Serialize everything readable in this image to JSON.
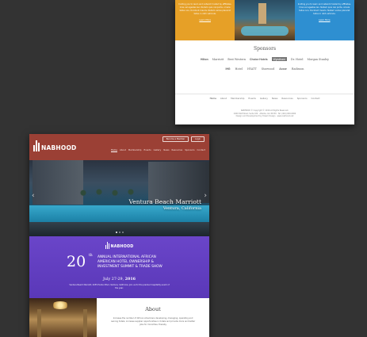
{
  "top_page": {
    "tiles": {
      "left_text": "Inviting you to learn and network hosted by affiliates. Cras vel egestas leo. Nullam quis nisi porta, ornare tellus non, tincidunt mauris. Nullam varius placerat tellus in nibh vehicula.",
      "left_link": "Learn More",
      "right_text": "Inviting you to learn and network hosted by affiliates. Cras vel egestas leo. Nullam quis nisi porta, ornare tellus non, tincidunt mauris. Nullam varius placerat tellus in nibh vehicula.",
      "right_link": "Learn More"
    },
    "sponsors_title": "Sponsors",
    "sponsors_row1": [
      "Hilton",
      "Marriott",
      "Best Western",
      "Choice Hotels",
      "Wyndham",
      "Dr. Hotel",
      "Morgan Stanley"
    ],
    "sponsors_row2": [
      "IHG",
      "Hotel",
      "HYATT",
      "Starwood",
      "Accor",
      "Radisson"
    ],
    "footer_nav": [
      "Home",
      "About",
      "Membership",
      "Events",
      "Gallery",
      "News",
      "Resources",
      "Sponsors",
      "Contact"
    ],
    "footer_copy_1": "NABHOOD © Copyright © 2016 All Rights Reserved.",
    "footer_copy_2": "4400 Wolf Road, Suite 100 · Atlanta, GA 30339 · Tel: (404) 000-0000",
    "footer_copy_3": "Design and Development by Dream Design · www.nabhood.net"
  },
  "main_page": {
    "logo": "NABHOOD",
    "header_buttons": [
      "Become a Member",
      "Login"
    ],
    "nav": [
      "Home",
      "About",
      "Membership",
      "Events",
      "Gallery",
      "News",
      "Resources",
      "Sponsors",
      "Contact"
    ],
    "hero": {
      "title": "Ventura Beach Marriott",
      "subtitle": "Ventura, California",
      "slide_count": 3,
      "active_slide": 1
    },
    "event": {
      "logo": "NABHOOD",
      "number": "20",
      "suffix": "th",
      "title_line1": "ANNUAL INTERNATIONAL AFRICAN",
      "title_line2": "AMERICAN HOTEL OWNERSHIP &",
      "title_line3": "INVESTMENT SUMMIT & TRADE SHOW",
      "date_prefix": "July 27-29, ",
      "date_year": "2016",
      "desc": "Ventura Beach Marriott, 2055 Harbor Blvd, Ventura, California. Join us for the premier hospitality event of the year."
    },
    "about": {
      "title": "About",
      "text": "Increase the number of African Americans developing, managing, operating and owning hotels; increase supplier opportunities in hotels and provide more and better jobs for minorities; thereby"
    }
  },
  "colors": {
    "background": "#333333",
    "header_red": "#9b4035",
    "event_purple": "#6a45c9",
    "tile_orange": "#e6a027",
    "tile_blue": "#2e8fd1"
  }
}
